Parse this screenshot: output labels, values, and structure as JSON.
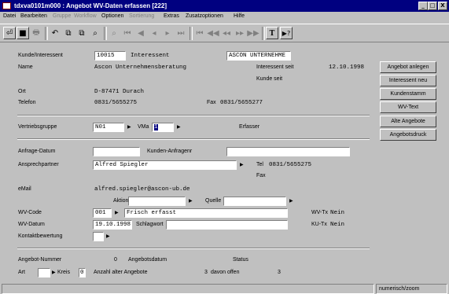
{
  "window": {
    "title": "tdxva0101m000 : Angebot WV-Daten erfassen [222]",
    "min": "_",
    "max": "□",
    "close": "X"
  },
  "menu": [
    {
      "label": "Datei",
      "disabled": false
    },
    {
      "label": "Bearbeiten",
      "disabled": false
    },
    {
      "label": "Gruppe",
      "disabled": true
    },
    {
      "label": "Workflow",
      "disabled": true
    },
    {
      "label": "Optionen",
      "disabled": false
    },
    {
      "label": "Sortierung",
      "disabled": true
    },
    {
      "label": "Extras",
      "disabled": false
    },
    {
      "label": "Zusatzoptionen",
      "disabled": false
    },
    {
      "label": "Hilfe",
      "disabled": false
    }
  ],
  "toolbar": {
    "exit": "⏎",
    "save": "■",
    "print": "🖶",
    "undo": "↶",
    "copy": "⧉",
    "paste": "⧉",
    "find": "⌕",
    "first": "⏮",
    "prev_page": "◀",
    "prev": "◂",
    "next": "▸",
    "last": "⏭",
    "g_first": "⏮",
    "g_prev_page": "◀◀",
    "g_prev": "◂◂",
    "g_next": "▸▸",
    "g_last": "▶▶",
    "text": "T",
    "help": "▶?"
  },
  "form": {
    "kunde_label": "Kunde/Interessent",
    "kunde_value": "10015",
    "kunde_type": "Interessent",
    "kunde_short": "ASCON UNTERNEHME",
    "name_label": "Name",
    "name_value": "Ascon Unternehmensberatung",
    "int_seit_label": "Interessent seit",
    "int_seit_value": "12.10.1998",
    "kunde_seit_label": "Kunde seit",
    "ort_label": "Ort",
    "ort_value": "D-87471 Durach",
    "telefon_label": "Telefon",
    "telefon_value": "0831/5655275",
    "fax_label": "Fax",
    "fax_value": "0831/5655277",
    "vtgruppe_label": "Vertriebsgruppe",
    "vtgruppe_value": "N01",
    "vma_label": "VMa",
    "vma_value": "1",
    "erfasser_label": "Erfasser",
    "anfrage_label": "Anfrage-Datum",
    "kundenanfr_label": "Kunden-Anfragenr",
    "ansprech_label": "Ansprechpartner",
    "ansprech_value": "Alfred Spiegler",
    "tel_label": "Tel",
    "tel_value": "0831/5655275",
    "fax2_label": "Fax",
    "email_label": "eMail",
    "email_value": "alfred.spiegler@ascon-ub.de",
    "aktion_label": "Aktion",
    "quelle_label": "Quelle",
    "wvcode_label": "WV-Code",
    "wvcode_value": "001",
    "wvcode_desc": "Frisch erfasst",
    "wvtx_label": "WV-Tx",
    "wvtx_value": "Nein",
    "wvdatum_label": "WV-Datum",
    "wvdatum_value": "19.10.1998",
    "schlagwort_label": "Schlagwort",
    "kutx_label": "KU-Tx",
    "kutx_value": "Nein",
    "kontakt_label": "Kontaktbewertung",
    "angnr_label": "Angebot-Nummer",
    "angnr_value": "0",
    "angdatum_label": "Angebotsdatum",
    "status_label": "Status",
    "art_label": "Art",
    "kreis_label": "Kreis",
    "kreis_value": "0",
    "anzahl_label": "Anzahl alter Angebote",
    "anzahl_value": "3",
    "offen_label": "davon offen",
    "offen_value": "3"
  },
  "buttons": {
    "angebot_anlegen": "Angebot anlegen",
    "interessent_neu": "Interessent neu",
    "kundenstamm": "Kundenstamm",
    "wv_text": "WV-Text",
    "alte_angebote": "Alte Angebote",
    "angebotsdruck": "Angebotsdruck"
  },
  "status": {
    "mode": "numerisch/zoom"
  }
}
